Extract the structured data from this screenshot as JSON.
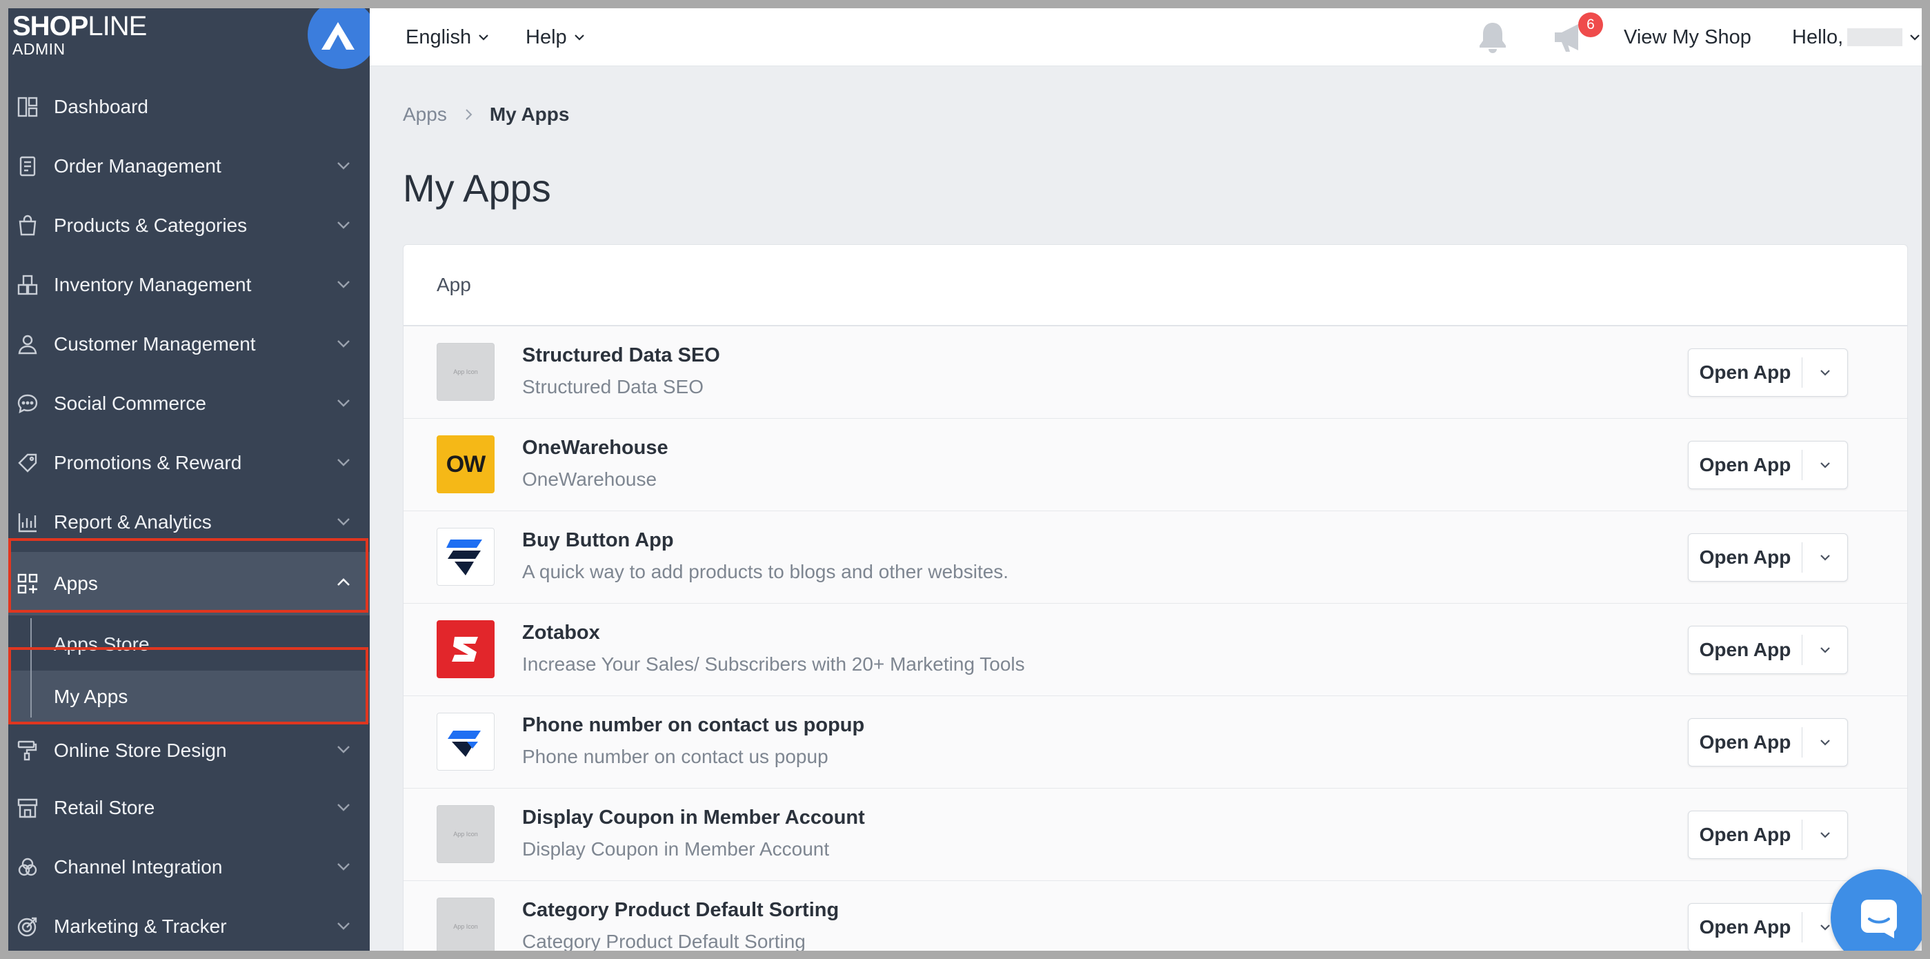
{
  "sidebar": {
    "logo_brand_bold": "SHOP",
    "logo_brand_light": "LINE",
    "logo_sub": "ADMIN",
    "items": [
      {
        "label": "Dashboard",
        "icon": "dashboard-icon"
      },
      {
        "label": "Order Management",
        "icon": "order-icon"
      },
      {
        "label": "Products & Categories",
        "icon": "shopping-bag-icon"
      },
      {
        "label": "Inventory Management",
        "icon": "inventory-icon"
      },
      {
        "label": "Customer Management",
        "icon": "customer-icon"
      },
      {
        "label": "Social Commerce",
        "icon": "chat-icon"
      },
      {
        "label": "Promotions & Reward",
        "icon": "tag-icon"
      },
      {
        "label": "Report & Analytics",
        "icon": "analytics-icon"
      },
      {
        "label": "Apps",
        "icon": "apps-icon"
      },
      {
        "label": "Online Store Design",
        "icon": "paint-roller-icon"
      },
      {
        "label": "Retail Store",
        "icon": "store-icon"
      },
      {
        "label": "Channel Integration",
        "icon": "channel-icon"
      },
      {
        "label": "Marketing & Tracker",
        "icon": "target-icon"
      }
    ],
    "apps_sub": [
      {
        "label": "Apps Store"
      },
      {
        "label": "My Apps"
      }
    ]
  },
  "topbar": {
    "language": "English",
    "help": "Help",
    "notification_count": "6",
    "view_shop": "View My Shop",
    "greeting": "Hello,"
  },
  "breadcrumb": {
    "parent": "Apps",
    "current": "My Apps"
  },
  "page_title": "My Apps",
  "table": {
    "header": "App",
    "button_label": "Open App",
    "rows": [
      {
        "name": "Structured Data SEO",
        "desc": "Structured Data SEO",
        "icon": "placeholder",
        "icon_text": "App Icon"
      },
      {
        "name": "OneWarehouse",
        "desc": "OneWarehouse",
        "icon": "onewarehouse",
        "icon_text": "OW"
      },
      {
        "name": "Buy Button App",
        "desc": "A quick way to add products to blogs and other websites.",
        "icon": "buybutton",
        "icon_text": ""
      },
      {
        "name": "Zotabox",
        "desc": "Increase Your Sales/ Subscribers with 20+ Marketing Tools",
        "icon": "zotabox",
        "icon_text": ""
      },
      {
        "name": "Phone number on contact us popup",
        "desc": "Phone number on contact us popup",
        "icon": "phone",
        "icon_text": ""
      },
      {
        "name": "Display Coupon in Member Account",
        "desc": "Display Coupon in Member Account",
        "icon": "placeholder",
        "icon_text": "App Icon"
      },
      {
        "name": "Category Product Default Sorting",
        "desc": "Category Product Default Sorting",
        "icon": "placeholder",
        "icon_text": "App Icon"
      }
    ]
  },
  "colors": {
    "sidebar_bg": "#384354",
    "highlight": "#e0361f",
    "badge": "#ef4b4b",
    "chat": "#3e8ee6"
  }
}
